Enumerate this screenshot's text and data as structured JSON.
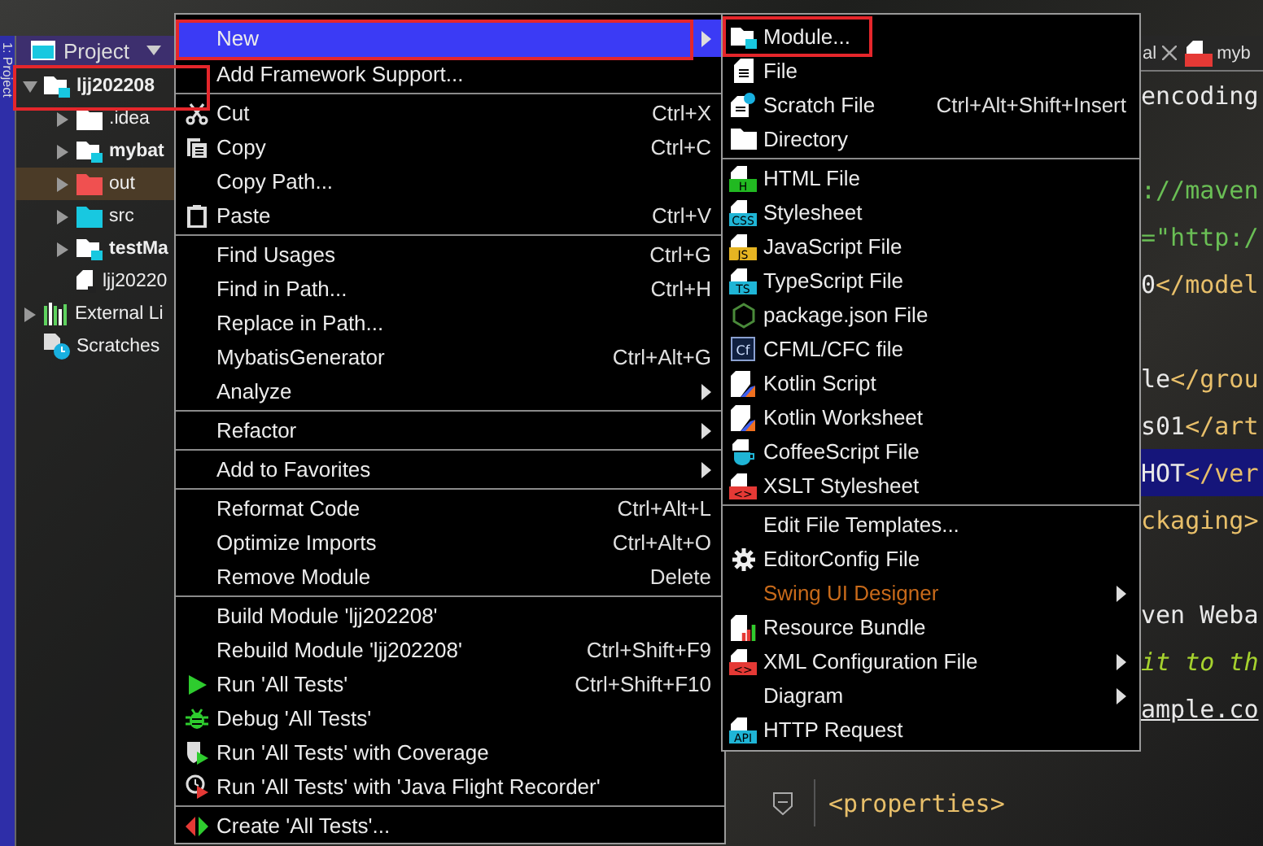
{
  "tool_strip": {
    "label": "1: Project"
  },
  "project_panel": {
    "title": "Project",
    "tree": [
      {
        "label": "ljj202208",
        "kind": "module",
        "bold": true,
        "expanded": true,
        "highlighted": true,
        "children": [
          {
            "label": ".idea",
            "kind": "folder",
            "bold": false,
            "expanded": false
          },
          {
            "label": "mybat",
            "kind": "module",
            "bold": true,
            "expanded": false
          },
          {
            "label": "out",
            "kind": "excluded-folder",
            "bold": false,
            "expanded": false,
            "excluded": true
          },
          {
            "label": "src",
            "kind": "source-folder",
            "bold": false,
            "expanded": false
          },
          {
            "label": "testMa",
            "kind": "module",
            "bold": true,
            "expanded": false
          },
          {
            "label": "ljj20220",
            "kind": "module-file",
            "bold": false
          }
        ]
      },
      {
        "label": "External Li",
        "kind": "library",
        "bold": false,
        "expanded": false
      },
      {
        "label": "Scratches",
        "kind": "scratches",
        "bold": false
      }
    ]
  },
  "editor": {
    "tabs": [
      {
        "label": "al",
        "closable": true
      },
      {
        "label": "myb",
        "kind": "badge-file",
        "color": "#e53935"
      }
    ],
    "lines_right": [
      {
        "spans": [
          {
            "text": "encoding",
            "kind": "plain"
          }
        ]
      },
      {
        "kind": "blank"
      },
      {
        "spans": [
          {
            "text": "://maven",
            "kind": "string"
          }
        ]
      },
      {
        "spans": [
          {
            "text": "=\"http:/",
            "kind": "string"
          }
        ]
      },
      {
        "spans": [
          {
            "text": "0",
            "kind": "plain"
          },
          {
            "text": "</model",
            "kind": "tag"
          }
        ]
      },
      {
        "kind": "blank"
      },
      {
        "spans": [
          {
            "text": "le",
            "kind": "plain"
          },
          {
            "text": "</grou",
            "kind": "tag"
          }
        ]
      },
      {
        "spans": [
          {
            "text": "s01",
            "kind": "plain"
          },
          {
            "text": "</art",
            "kind": "tag"
          }
        ]
      },
      {
        "selected": true,
        "spans": [
          {
            "text": "HOT",
            "kind": "plain"
          },
          {
            "text": "</ver",
            "kind": "tag"
          }
        ]
      },
      {
        "spans": [
          {
            "text": "ckaging>",
            "kind": "tag"
          }
        ]
      },
      {
        "kind": "blank"
      },
      {
        "spans": [
          {
            "text": "ven Weba",
            "kind": "plain"
          }
        ]
      },
      {
        "spans": [
          {
            "text": "it to th",
            "kind": "comment"
          }
        ]
      },
      {
        "spans": [
          {
            "text": "ample.co",
            "kind": "link"
          }
        ]
      },
      {
        "kind": "blank"
      }
    ],
    "lines_lower": [
      {
        "foldable": true,
        "spans": [
          {
            "text": "<properties>",
            "kind": "tag"
          }
        ]
      }
    ]
  },
  "context_menu": {
    "groups": [
      [
        {
          "label": "New",
          "submenu": true,
          "selected": true,
          "highlighted": true
        },
        {
          "label": "Add Framework Support...",
          "selected": false
        }
      ],
      [
        {
          "label": "Cut",
          "shortcut": "Ctrl+X",
          "kind": "scissors",
          "selected": false
        },
        {
          "label": "Copy",
          "shortcut": "Ctrl+C",
          "kind": "copy",
          "selected": false
        },
        {
          "label": "Copy Path...",
          "selected": false
        },
        {
          "label": "Paste",
          "shortcut": "Ctrl+V",
          "kind": "paste",
          "selected": false
        }
      ],
      [
        {
          "label": "Find Usages",
          "shortcut": "Ctrl+G",
          "selected": false
        },
        {
          "label": "Find in Path...",
          "shortcut": "Ctrl+H",
          "selected": false
        },
        {
          "label": "Replace in Path...",
          "selected": false
        },
        {
          "label": "MybatisGenerator",
          "shortcut": "Ctrl+Alt+G",
          "selected": false
        },
        {
          "label": "Analyze",
          "submenu": true,
          "selected": false
        }
      ],
      [
        {
          "label": "Refactor",
          "submenu": true,
          "selected": false
        }
      ],
      [
        {
          "label": "Add to Favorites",
          "submenu": true,
          "selected": false
        }
      ],
      [
        {
          "label": "Reformat Code",
          "shortcut": "Ctrl+Alt+L",
          "selected": false
        },
        {
          "label": "Optimize Imports",
          "shortcut": "Ctrl+Alt+O",
          "selected": false
        },
        {
          "label": "Remove Module",
          "shortcut": "Delete",
          "selected": false
        }
      ],
      [
        {
          "label": "Build Module 'ljj202208'",
          "selected": false
        },
        {
          "label": "Rebuild Module 'ljj202208'",
          "shortcut": "Ctrl+Shift+F9",
          "selected": false
        },
        {
          "label": "Run 'All Tests'",
          "shortcut": "Ctrl+Shift+F10",
          "kind": "run",
          "selected": false
        },
        {
          "label": "Debug 'All Tests'",
          "kind": "debug",
          "selected": false
        },
        {
          "label": "Run 'All Tests' with Coverage",
          "kind": "coverage",
          "selected": false
        },
        {
          "label": "Run 'All Tests' with 'Java Flight Recorder'",
          "kind": "recorder",
          "selected": false
        }
      ],
      [
        {
          "label": "Create 'All Tests'...",
          "kind": "create",
          "selected": false
        }
      ]
    ]
  },
  "new_submenu": {
    "groups": [
      [
        {
          "label": "Module...",
          "kind": "module",
          "highlighted": true
        },
        {
          "label": "File",
          "kind": "file"
        },
        {
          "label": "Scratch File",
          "shortcut": "Ctrl+Alt+Shift+Insert",
          "kind": "scratch"
        },
        {
          "label": "Directory",
          "kind": "folder"
        }
      ],
      [
        {
          "label": "HTML File",
          "kind": "badge-file",
          "badge": "H",
          "color": "#21b921"
        },
        {
          "label": "Stylesheet",
          "kind": "badge-file",
          "badge": "CSS",
          "color": "#1fb5d6"
        },
        {
          "label": "JavaScript File",
          "kind": "badge-file",
          "badge": "JS",
          "color": "#e6b422"
        },
        {
          "label": "TypeScript File",
          "kind": "badge-file",
          "badge": "TS",
          "color": "#1fb5d6"
        },
        {
          "label": "package.json File",
          "kind": "hexagon"
        },
        {
          "label": "CFML/CFC file",
          "kind": "badge-square",
          "badge": "Cf"
        },
        {
          "label": "Kotlin Script",
          "kind": "kotlin"
        },
        {
          "label": "Kotlin Worksheet",
          "kind": "kotlin"
        },
        {
          "label": "CoffeeScript File",
          "kind": "cup"
        },
        {
          "label": "XSLT Stylesheet",
          "kind": "badge-file",
          "badge": "<>",
          "color": "#e53935"
        }
      ],
      [
        {
          "label": "Edit File Templates..."
        },
        {
          "label": "EditorConfig File",
          "kind": "gear"
        },
        {
          "label": "Swing UI Designer",
          "submenu": true,
          "disabled": true
        },
        {
          "label": "Resource Bundle",
          "kind": "bundle"
        },
        {
          "label": "XML Configuration File",
          "submenu": true,
          "kind": "badge-file",
          "badge": "<>",
          "color": "#e53935"
        },
        {
          "label": "Diagram",
          "submenu": true
        },
        {
          "label": "HTTP Request",
          "kind": "badge-file",
          "badge": "API",
          "color": "#1fb5d6"
        }
      ]
    ]
  }
}
